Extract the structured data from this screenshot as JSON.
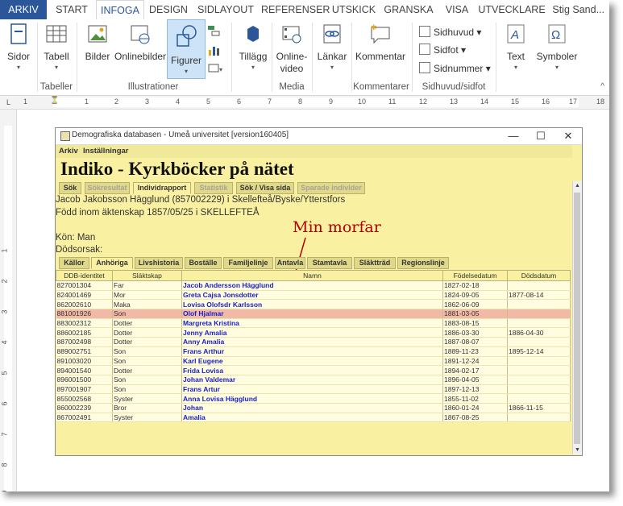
{
  "ribbon": {
    "tabs": [
      "ARKIV",
      "START",
      "INFOGA",
      "DESIGN",
      "SIDLAYOUT",
      "REFERENSER",
      "UTSKICK",
      "GRANSKA",
      "VISA",
      "UTVECKLARE"
    ],
    "active_tab": "INFOGA",
    "user": "Stig Sand...",
    "buttons": {
      "pages": "Sidor",
      "table": "Tabell",
      "pictures": "Bilder",
      "online_pictures": "Onlinebilder",
      "shapes": "Figurer",
      "addins": "Tillägg",
      "online_video": "Online-\nvideo",
      "links": "Länkar",
      "comment": "Kommentar",
      "header": "Sidhuvud",
      "footer": "Sidfot",
      "page_number": "Sidnummer",
      "text": "Text",
      "symbols": "Symboler"
    },
    "groups": {
      "tables": "Tabeller",
      "illustrations": "Illustrationer",
      "media": "Media",
      "comments": "Kommentarer",
      "header_footer": "Sidhuvud/sidfot"
    },
    "ruler_numbers": [
      "1",
      "1",
      "2",
      "3",
      "4",
      "5",
      "6",
      "7",
      "8",
      "9",
      "10",
      "11",
      "12",
      "13",
      "14",
      "15",
      "16",
      "17",
      "18"
    ],
    "vruler_numbers": [
      "1",
      "2",
      "3",
      "4",
      "5",
      "6",
      "7",
      "8",
      "9",
      "10",
      "11"
    ]
  },
  "app": {
    "window_title": "Demografiska databasen - Umeå universitet  [version160405]",
    "menu": [
      "Arkiv",
      "Inställningar"
    ],
    "heading": "Indiko - Kyrkböcker på nätet",
    "subtabs": [
      "Sök",
      "Sökresultat",
      "Individrapport",
      "Statistik",
      "Sök / Visa sida",
      "Sparade individer"
    ],
    "active_subtab": "Individrapport",
    "person_line": "Jacob Jakobsson Hägglund (857002229) i Skellefteå/Byske/Ytterstfors",
    "birth_line": "Född inom äktenskap 1857/05/25 i SKELLEFTEÅ",
    "sex_line": "Kön: Man",
    "death_cause_line": "Dödsorsak:",
    "annotation": "Min morfar",
    "detail_tabs": [
      "Källor",
      "Anhöriga",
      "Livshistoria",
      "Boställe",
      "Familjelinje",
      "Antavla",
      "Stamtavla",
      "Släktträd",
      "Regionslinje"
    ],
    "active_detail_tab": "Anhöriga",
    "columns": [
      "DDB-identitet",
      "Släktskap",
      "Namn",
      "Födelsedatum",
      "Dödsdatum"
    ],
    "rows": [
      [
        "827001304",
        "Far",
        "Jacob Andersson Hägglund",
        "1827-02-18",
        ""
      ],
      [
        "824001469",
        "Mor",
        "Greta Cajsa Jonsdotter",
        "1824-09-05",
        "1877-08-14"
      ],
      [
        "862002610",
        "Maka",
        "Lovisa Olofsdr Karlsson",
        "1862-06-09",
        ""
      ],
      [
        "881001926",
        "Son",
        "Olof Hjalmar",
        "1881-03-05",
        ""
      ],
      [
        "883002312",
        "Dotter",
        "Margreta Kristina",
        "1883-08-15",
        ""
      ],
      [
        "886002185",
        "Dotter",
        "Jenny Amalia",
        "1886-03-30",
        "1886-04-30"
      ],
      [
        "887002498",
        "Dotter",
        "Anny Amalia",
        "1887-08-07",
        ""
      ],
      [
        "889002751",
        "Son",
        "Frans Arthur",
        "1889-11-23",
        "1895-12-14"
      ],
      [
        "891003020",
        "Son",
        "Karl Eugene",
        "1891-12-24",
        ""
      ],
      [
        "894001540",
        "Dotter",
        "Frida Lovisa",
        "1894-02-17",
        ""
      ],
      [
        "896001500",
        "Son",
        "Johan Valdemar",
        "1896-04-05",
        ""
      ],
      [
        "897001907",
        "Son",
        "Frans Artur",
        "1897-12-13",
        ""
      ],
      [
        "855002568",
        "Syster",
        "Anna Lovisa Hägglund",
        "1855-11-02",
        ""
      ],
      [
        "860002239",
        "Bror",
        "Johan",
        "1860-01-24",
        "1866-11-15"
      ],
      [
        "867002491",
        "Syster",
        "Amalia",
        "1867-08-25",
        ""
      ]
    ],
    "highlighted_row": 3
  }
}
